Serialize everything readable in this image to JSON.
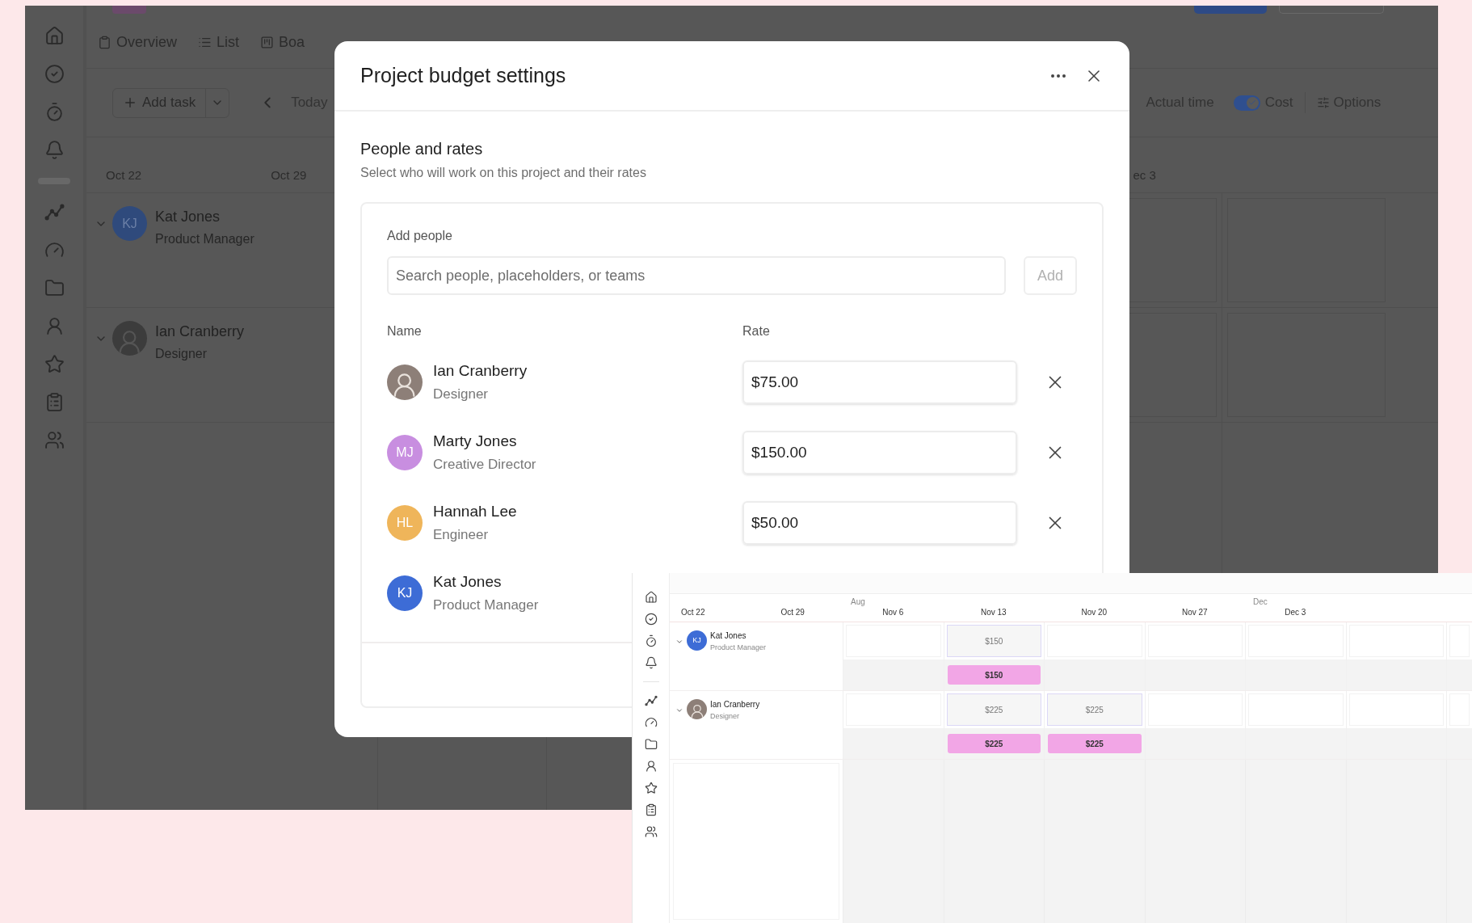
{
  "background_app": {
    "tabs": [
      {
        "label": "Overview"
      },
      {
        "label": "List"
      },
      {
        "label": "Boa"
      }
    ],
    "toolbar": {
      "add_task": "Add task",
      "today": "Today",
      "actual_time": "Actual time",
      "cost_toggle": {
        "label": "Cost",
        "on": true
      },
      "options": "Options"
    },
    "dates": [
      "Oct 22",
      "Oct 29"
    ],
    "dates_right": [
      "ec 3"
    ],
    "people": [
      {
        "name": "Kat Jones",
        "role": "Product Manager",
        "avatar": {
          "kind": "initials",
          "initials": "KJ"
        }
      },
      {
        "name": "Ian Cranberry",
        "role": "Designer",
        "avatar": {
          "kind": "photo"
        }
      }
    ]
  },
  "dialog": {
    "title": "Project budget settings",
    "section_title": "People and rates",
    "section_subtitle": "Select who will work on this project and their rates",
    "add_people": {
      "label": "Add people",
      "placeholder": "Search people, placeholders, or teams",
      "button": {
        "label": "Add",
        "disabled": true
      }
    },
    "columns": [
      "Name",
      "Rate"
    ],
    "people": [
      {
        "name": "Ian Cranberry",
        "role": "Designer",
        "avatar": {
          "kind": "photo"
        },
        "rate": "$75.00"
      },
      {
        "name": "Marty Jones",
        "role": "Creative Director",
        "avatar": {
          "kind": "initials",
          "initials": "MJ",
          "color": "#c88ee0"
        },
        "rate": "$150.00"
      },
      {
        "name": "Hannah Lee",
        "role": "Engineer",
        "avatar": {
          "kind": "initials",
          "initials": "HL",
          "color": "#efb55a"
        },
        "rate": "$50.00"
      },
      {
        "name": "Kat Jones",
        "role": "Product Manager",
        "avatar": {
          "kind": "initials",
          "initials": "KJ",
          "color": "#3d6cd6"
        }
      }
    ]
  },
  "inset": {
    "weeks": [
      {
        "label": "Oct 22"
      },
      {
        "label": "Oct 29"
      },
      {
        "label": "Nov 6",
        "month": "Aug"
      },
      {
        "label": "Nov 13"
      },
      {
        "label": "Nov 20"
      },
      {
        "label": "Nov 27"
      },
      {
        "label": "Dec 3",
        "month": "Dec"
      }
    ],
    "people": [
      {
        "name": "Kat Jones",
        "role": "Product Manager",
        "avatar": {
          "kind": "initials",
          "initials": "KJ",
          "color": "#3d6cd6"
        },
        "cells": [
          {},
          {
            "estimate": "$150",
            "cost": "$150"
          },
          {},
          {},
          {},
          {},
          {}
        ]
      },
      {
        "name": "Ian Cranberry",
        "role": "Designer",
        "avatar": {
          "kind": "photo"
        },
        "cells": [
          {},
          {
            "estimate": "$225",
            "cost": "$225"
          },
          {
            "estimate": "$225",
            "cost": "$225"
          },
          {},
          {},
          {},
          {}
        ]
      }
    ]
  }
}
